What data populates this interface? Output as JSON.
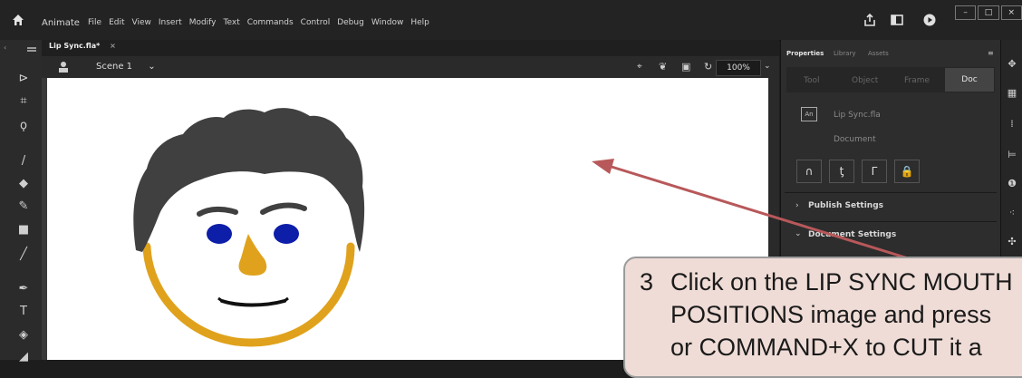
{
  "app": {
    "name": "Animate"
  },
  "menu": [
    "File",
    "Edit",
    "View",
    "Insert",
    "Modify",
    "Text",
    "Commands",
    "Control",
    "Debug",
    "Window",
    "Help"
  ],
  "window_controls": [
    "–",
    "□",
    "×"
  ],
  "document_tab": {
    "label": "Lip Sync.fla*",
    "close": "×"
  },
  "scene": {
    "label": "Scene 1"
  },
  "zoom": {
    "value": "100%"
  },
  "panel": {
    "tabs": [
      "Properties",
      "Library",
      "Assets"
    ],
    "subtabs": [
      "Tool",
      "Object",
      "Frame",
      "Doc"
    ],
    "doc_icon": "An",
    "document_name": "Lip Sync.fla",
    "document_type": "Document",
    "buttons": [
      "∩",
      "ƫ",
      "Γ",
      "🔒"
    ],
    "sections": [
      "Publish Settings",
      "Document Settings"
    ]
  },
  "callout": {
    "number": "3",
    "line1": "Click on the LIP SYNC MOUTH",
    "line2": "POSITIONS image and press",
    "line3": "or COMMAND+X to CUT it a"
  },
  "colors": {
    "hair": "#404040",
    "skin_outline": "#e0a21c",
    "eyes": "#0d1ea8",
    "nose": "#e0a21c",
    "arrow": "#b8585a",
    "callout_bg": "#efdcd6"
  }
}
